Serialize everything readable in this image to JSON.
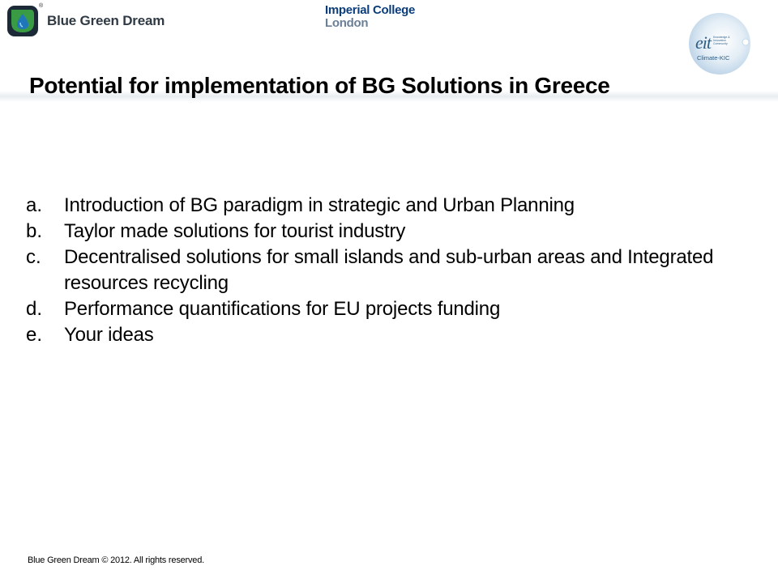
{
  "header": {
    "bgd_logo": {
      "name": "Blue Green Dream",
      "registered_mark": "®",
      "icon": "blue-green-dream-leaf-drop-icon",
      "colors": {
        "green": "#2e8a3c",
        "blue": "#1f76b8",
        "dark": "#1b2a36"
      }
    },
    "imperial_logo": {
      "line1": "Imperial College",
      "line2": "London",
      "colors": {
        "primary": "#0b3d7a",
        "secondary": "#6b7f98"
      }
    },
    "eit_logo": {
      "word": "eit",
      "small_text": "Knowledge & Innovation Community",
      "subtitle": "Climate-KIC",
      "color": "#2d5e86"
    }
  },
  "slide": {
    "title": "Potential for implementation of BG Solutions in Greece",
    "items": [
      {
        "marker": "a.",
        "text": "Introduction of BG paradigm in strategic and Urban Planning"
      },
      {
        "marker": "b.",
        "text": "Taylor made solutions for tourist industry"
      },
      {
        "marker": "c.",
        "text": "Decentralised solutions for small islands and sub-urban areas and Integrated resources recycling"
      },
      {
        "marker": "d.",
        "text": "Performance quantifications for EU projects funding"
      },
      {
        "marker": "e.",
        "text": "Your ideas"
      }
    ]
  },
  "footer": {
    "copyright": "Blue Green Dream © 2012. All rights reserved."
  }
}
